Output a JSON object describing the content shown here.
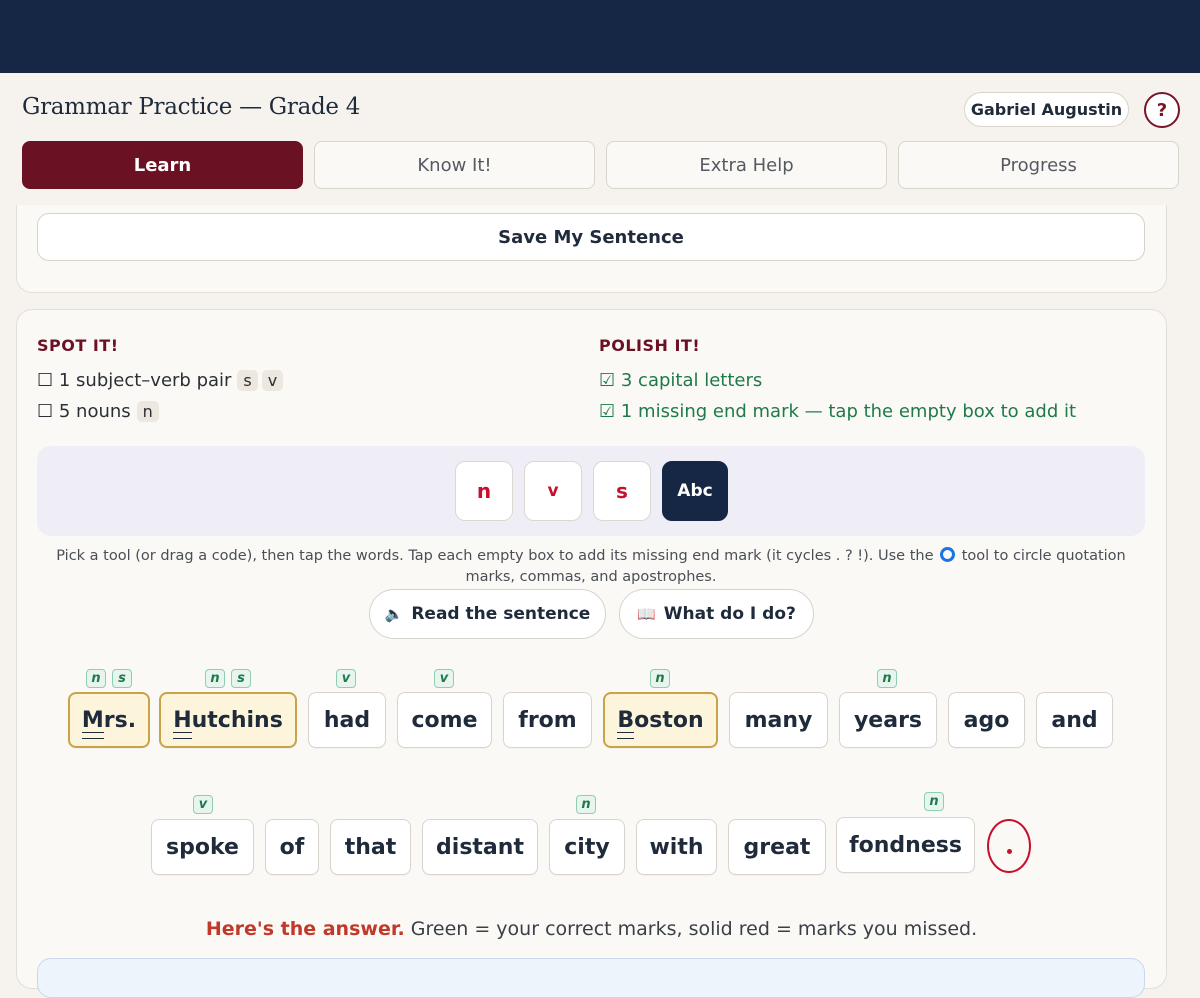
{
  "app": {
    "title": "Grammar Practice — Grade 4"
  },
  "user": {
    "name": "Gabriel Augustin",
    "help_label": "?"
  },
  "tabs": [
    {
      "label": "Learn"
    },
    {
      "label": "Know It!"
    },
    {
      "label": "Extra Help"
    },
    {
      "label": "Progress"
    }
  ],
  "save_button": "Save My Sentence",
  "spot_it": {
    "heading": "SPOT IT!",
    "items": [
      {
        "box": "☐",
        "text": "1 subject–verb pair",
        "codes": [
          "s",
          "v"
        ]
      },
      {
        "box": "☐",
        "text": "5 nouns",
        "codes": [
          "n"
        ]
      }
    ]
  },
  "polish_it": {
    "heading": "POLISH IT!",
    "items": [
      {
        "box": "☑",
        "text": "3 capital letters"
      },
      {
        "box": "☑",
        "text": "1 missing end mark — tap the empty box to add it"
      }
    ]
  },
  "tools": [
    "n",
    "v",
    "s",
    "Abc"
  ],
  "instructions": {
    "before": "Pick a tool (or drag a code), then tap the words. Tap each empty box to add its missing end mark (it cycles . ? !). Use the",
    "after": "tool to circle quotation marks, commas, and apostrophes."
  },
  "actions": {
    "read": {
      "icon": "🔈",
      "label": "Read the sentence"
    },
    "help": {
      "icon": "📖",
      "label": "What do I do?"
    }
  },
  "sentence": {
    "line1": [
      {
        "word": "Mrs.",
        "cap": "M",
        "rest": "rs.",
        "marks": [
          "n",
          "s"
        ],
        "circled": true
      },
      {
        "word": "Hutchins",
        "cap": "H",
        "rest": "utchins",
        "marks": [
          "n",
          "s"
        ],
        "circled": true
      },
      {
        "word": "had",
        "marks": [
          "v"
        ]
      },
      {
        "word": "come",
        "marks": [
          "v"
        ]
      },
      {
        "word": "from",
        "marks": []
      },
      {
        "word": "Boston",
        "cap": "B",
        "rest": "oston",
        "marks": [
          "n"
        ],
        "circled": true
      },
      {
        "word": "many",
        "marks": []
      },
      {
        "word": "years",
        "marks": [
          "n"
        ]
      },
      {
        "word": "ago",
        "marks": []
      },
      {
        "word": "and",
        "marks": []
      }
    ],
    "line2": [
      {
        "word": "spoke",
        "marks": [
          "v"
        ]
      },
      {
        "word": "of",
        "marks": []
      },
      {
        "word": "that",
        "marks": []
      },
      {
        "word": "distant",
        "marks": []
      },
      {
        "word": "city",
        "marks": [
          "n"
        ]
      },
      {
        "word": "with",
        "marks": []
      },
      {
        "word": "great",
        "marks": []
      },
      {
        "word": "fondness",
        "marks": [
          "n"
        ]
      }
    ],
    "end_mark": "."
  },
  "answer": {
    "lead": "Here's the answer.",
    "text": "Green = your correct marks, solid red = marks you missed."
  },
  "colors": {
    "navy": "#152744",
    "maroon": "#6a1224",
    "tool_red": "#c8102e",
    "correct_green": "#1f7a4a",
    "circle_gold": "#caa24a",
    "answer_red": "#c0392b"
  }
}
